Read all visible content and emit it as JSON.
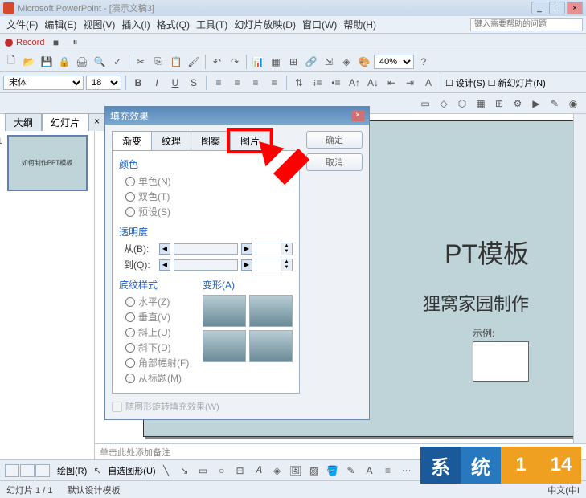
{
  "titlebar": {
    "app": "Microsoft PowerPoint",
    "doc": "[演示文稿3]"
  },
  "menu": {
    "file": "文件(F)",
    "edit": "编辑(E)",
    "view": "视图(V)",
    "insert": "插入(I)",
    "format": "格式(Q)",
    "tools": "工具(T)",
    "slideshow": "幻灯片放映(D)",
    "window": "窗口(W)",
    "help": "帮助(H)"
  },
  "help_placeholder": "键入需要帮助的问题",
  "record": {
    "label": "Record"
  },
  "zoom": "40%",
  "font": {
    "name": "宋体",
    "size": "18"
  },
  "format_buttons": {
    "bold": "B",
    "italic": "I",
    "underline": "U",
    "shadow": "S"
  },
  "design_label": "设计(S)",
  "newslide_label": "新幻灯片(N)",
  "tabs": {
    "outline": "大纲",
    "slides": "幻灯片"
  },
  "thumb": {
    "num": "1",
    "text": "如何制作PPT模板"
  },
  "slide": {
    "title": "PT模板",
    "subtitle": "狸窝家园制作",
    "sample": "示例:"
  },
  "notes": "单击此处添加备注",
  "dialog": {
    "title": "填充效果",
    "tabs": {
      "gradient": "渐变",
      "texture": "纹理",
      "pattern": "图案",
      "picture": "图片"
    },
    "ok": "确定",
    "cancel": "取消",
    "color_group": "颜色",
    "one_color": "单色(N)",
    "two_color": "双色(T)",
    "preset": "预设(S)",
    "trans_group": "透明度",
    "from": "从(B):",
    "to": "到(Q):",
    "from_val": "",
    "to_val": "",
    "shading_group": "底纹样式",
    "variant_group": "变形(A)",
    "horizontal": "水平(Z)",
    "vertical": "垂直(V)",
    "diag_up": "斜上(U)",
    "diag_down": "斜下(D)",
    "corner": "角部幅射(F)",
    "from_title": "从标题(M)",
    "rotate_checkbox": "随图形旋转填充效果(W)"
  },
  "drawbar": {
    "draw": "绘图(R)",
    "autoshape": "自选图形(U)"
  },
  "status": {
    "slide": "幻灯片 1 / 1",
    "template": "默认设计模板",
    "lang": "中文(中I"
  },
  "watermark": {
    "b1": "系",
    "b2": "统",
    "b3": "1",
    "b4": "14"
  }
}
